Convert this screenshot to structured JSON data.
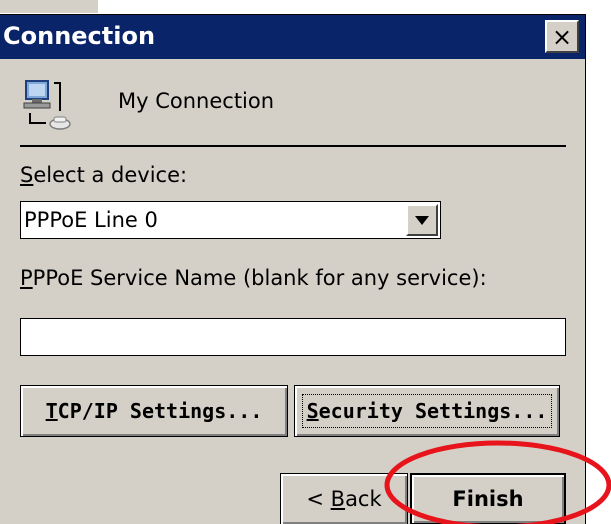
{
  "window": {
    "title": "Connection",
    "close_symbol": "×"
  },
  "header": {
    "connection_name": "My Connection",
    "icon": "network-connection-icon"
  },
  "device": {
    "label_accel": "S",
    "label_rest": "elect a device:",
    "selected_value": "PPPoE Line 0"
  },
  "service": {
    "label_accel": "P",
    "label_rest": "PPoE Service Name (blank for any service):",
    "value": ""
  },
  "buttons": {
    "tcpip_accel": "T",
    "tcpip_rest": "CP/IP Settings...",
    "security_accel": "S",
    "security_rest": "ecurity Settings...",
    "back_prefix": "< ",
    "back_accel": "B",
    "back_rest": "ack",
    "finish": "Finish"
  },
  "colors": {
    "titlebar": "#0a246a",
    "window_bg": "#d4d0c8",
    "annotation": "#e8141b"
  }
}
